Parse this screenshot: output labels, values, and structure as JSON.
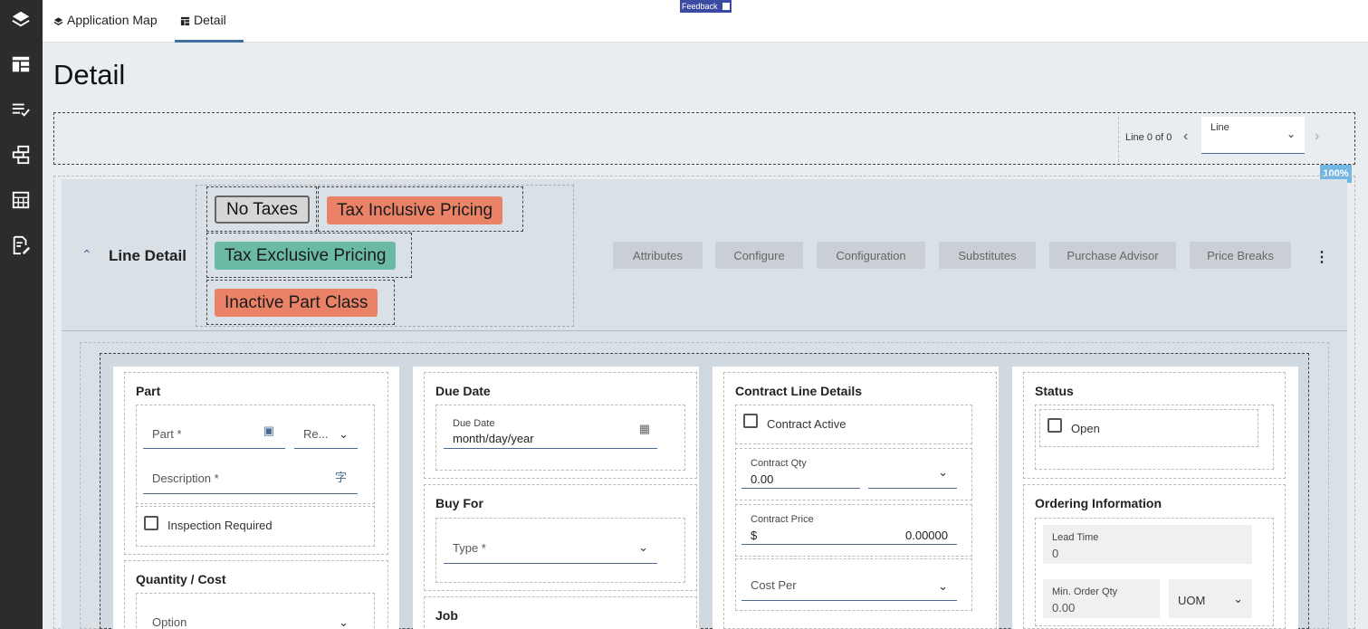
{
  "top_tabs": [
    {
      "label": "Application Map"
    },
    {
      "label": "Detail"
    }
  ],
  "feedback_label": "Feedback",
  "page_title": "Detail",
  "navigator": {
    "line_count": "Line 0 of 0",
    "select_label": "Line",
    "prev_icon": "chevron-left",
    "next_icon": "chevron-right"
  },
  "zoom": "100%",
  "line_detail": {
    "title": "Line Detail",
    "badges": [
      {
        "label": "No Taxes",
        "color": "#d6d6d6"
      },
      {
        "label": "Tax Inclusive Pricing",
        "color": "#e98267"
      },
      {
        "label": "Tax Exclusive Pricing",
        "color": "#6bbba4"
      },
      {
        "label": "Inactive Part Class",
        "color": "#e98267"
      }
    ],
    "actions": [
      "Attributes",
      "Configure",
      "Configuration",
      "Substitutes",
      "Purchase Advisor",
      "Price Breaks"
    ]
  },
  "part": {
    "title": "Part",
    "part_placeholder": "Part *",
    "rev_placeholder": "Re...",
    "description_placeholder": "Description *",
    "inspection_label": "Inspection Required"
  },
  "quantity_cost": {
    "title": "Quantity / Cost",
    "option_placeholder": "Option"
  },
  "due_date": {
    "title": "Due Date",
    "label": "Due Date",
    "value": "month/day/year"
  },
  "buy_for": {
    "title": "Buy For",
    "type_placeholder": "Type *"
  },
  "job": {
    "title": "Job"
  },
  "contract": {
    "title": "Contract Line Details",
    "active_label": "Contract Active",
    "qty_label": "Contract Qty",
    "qty_value": "0.00",
    "price_label": "Contract Price",
    "price_currency": "$",
    "price_value": "0.00000",
    "cost_per_placeholder": "Cost Per"
  },
  "status": {
    "title": "Status",
    "open_label": "Open"
  },
  "ordering": {
    "title": "Ordering Information",
    "lead_time_label": "Lead Time",
    "lead_time_value": "0",
    "min_qty_label": "Min. Order Qty",
    "min_qty_value": "0.00",
    "uom_placeholder": "UOM"
  },
  "colors": {
    "sidebar": "#2c2c2c",
    "accent": "#3f6ea0",
    "panel": "#d9e0e6",
    "badge_red": "#e98267",
    "badge_green": "#6bbba4"
  },
  "sidebar_icons": [
    "layers-icon",
    "layout-icon",
    "checklist-icon",
    "workflow-icon",
    "table-icon",
    "edit-document-icon"
  ]
}
